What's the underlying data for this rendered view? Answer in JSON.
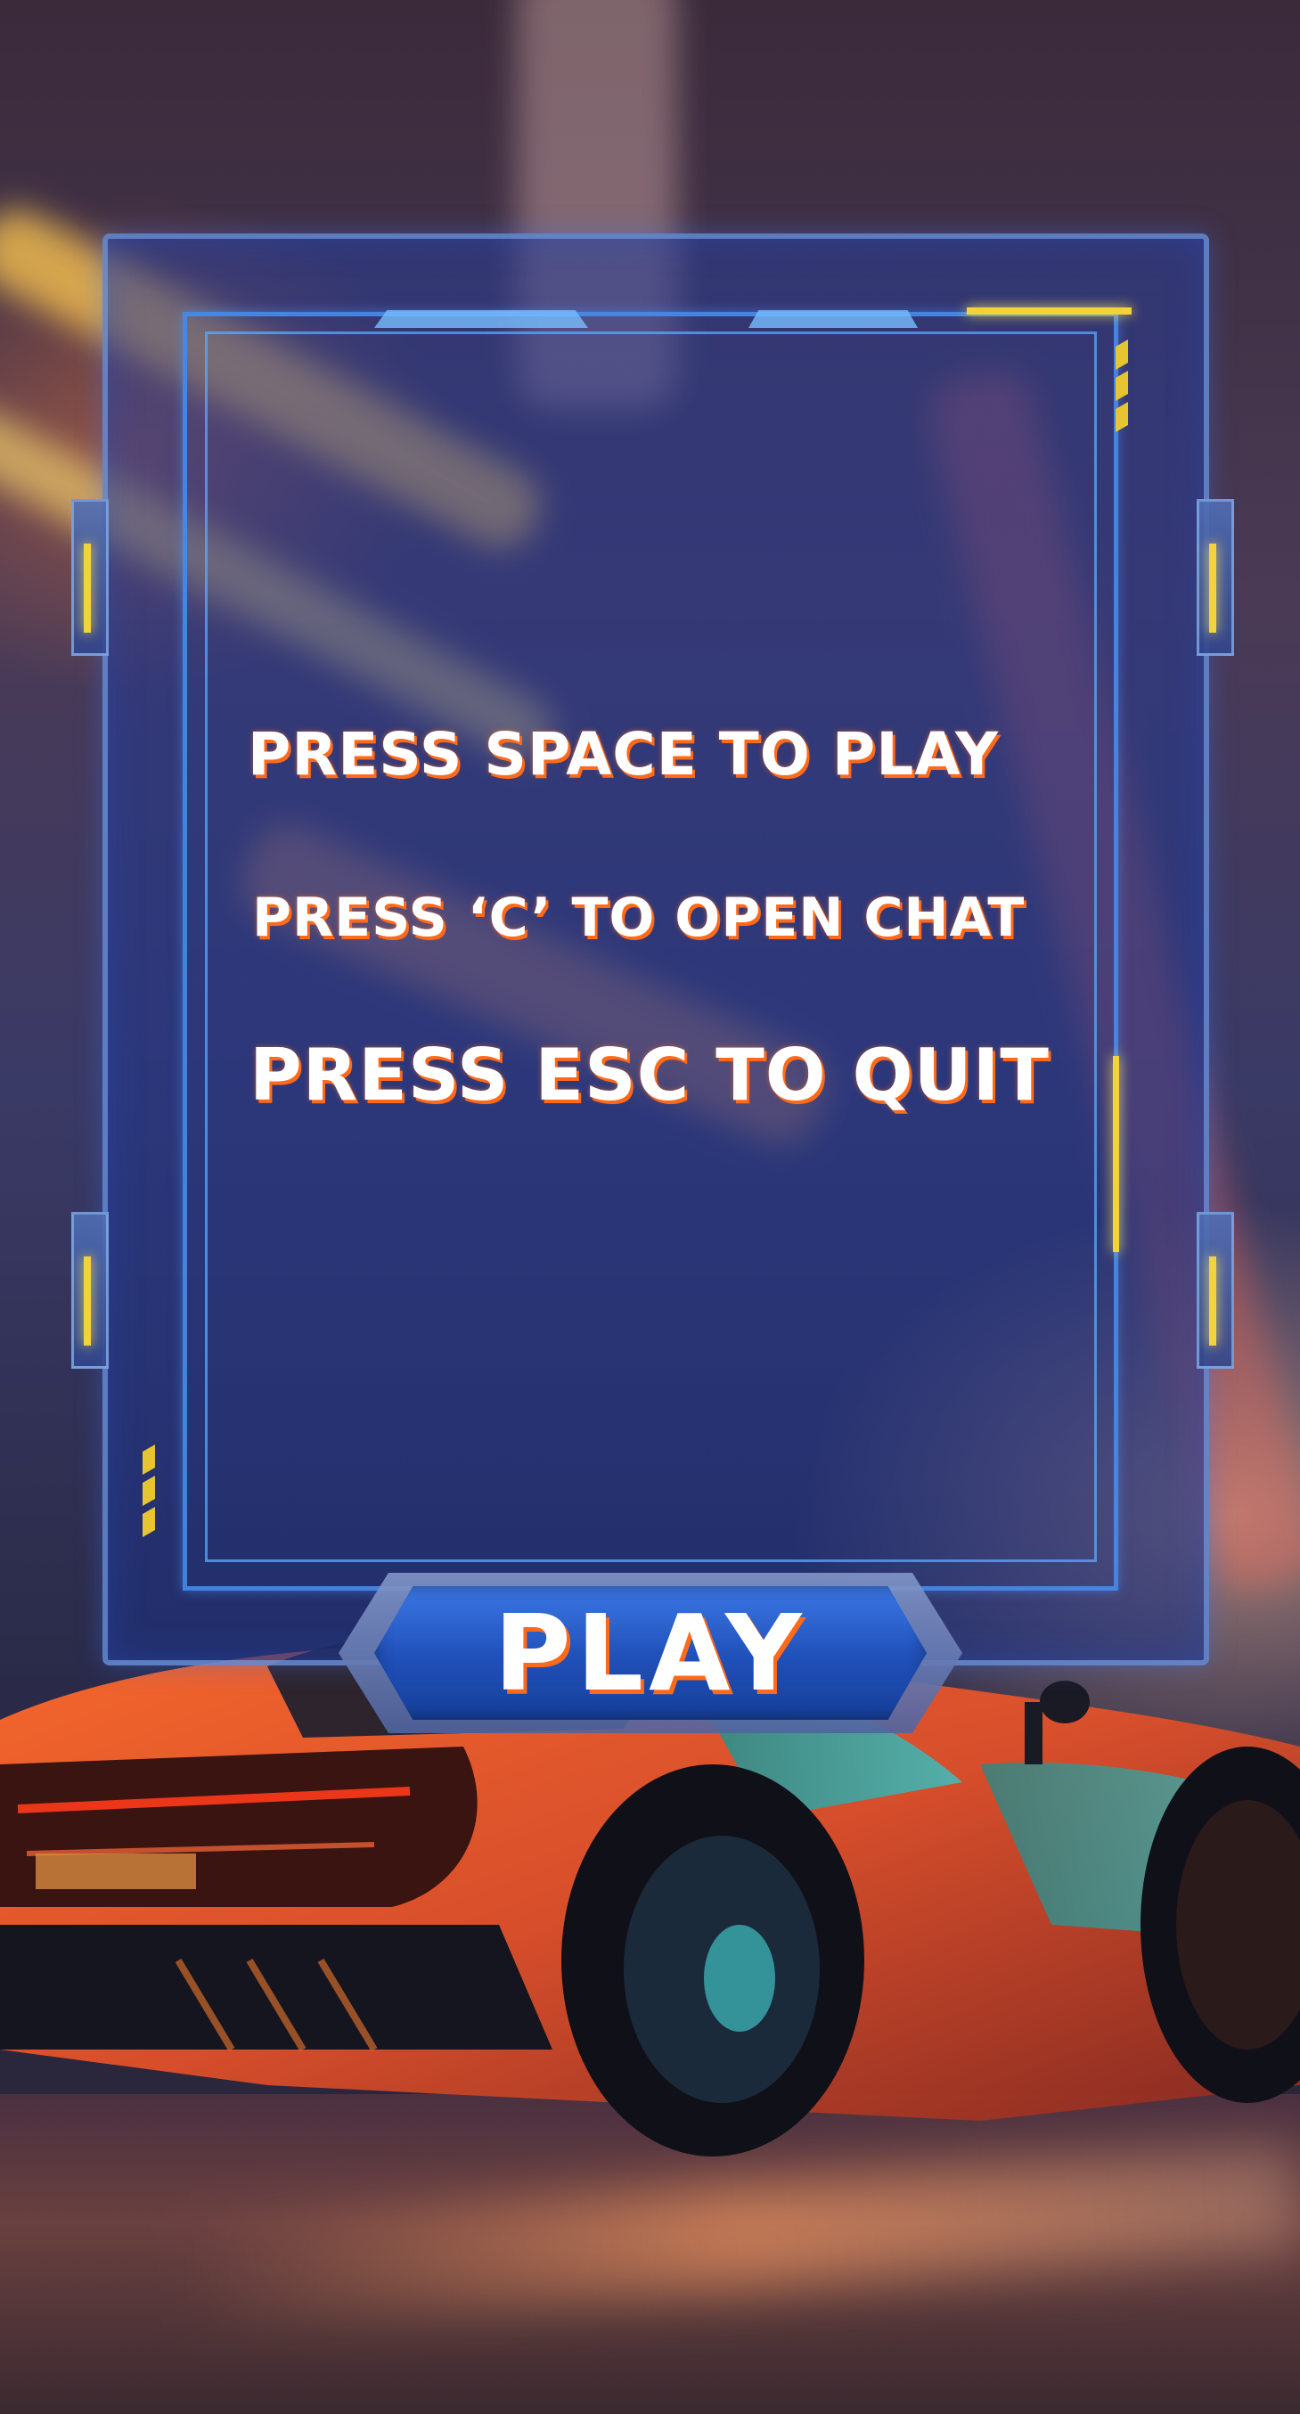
{
  "instructions": {
    "play": "PRESS SPACE TO PLAY",
    "chat": "PRESS ‘C’ TO OPEN CHAT",
    "quit": "PRESS ESC TO QUIT"
  },
  "play_button": {
    "label": "PLAY"
  },
  "colors": {
    "text": "#ffffff",
    "text_shadow": "#ff6a1a",
    "frame": "#3b78e6",
    "accent_yellow": "#f2d43a"
  }
}
